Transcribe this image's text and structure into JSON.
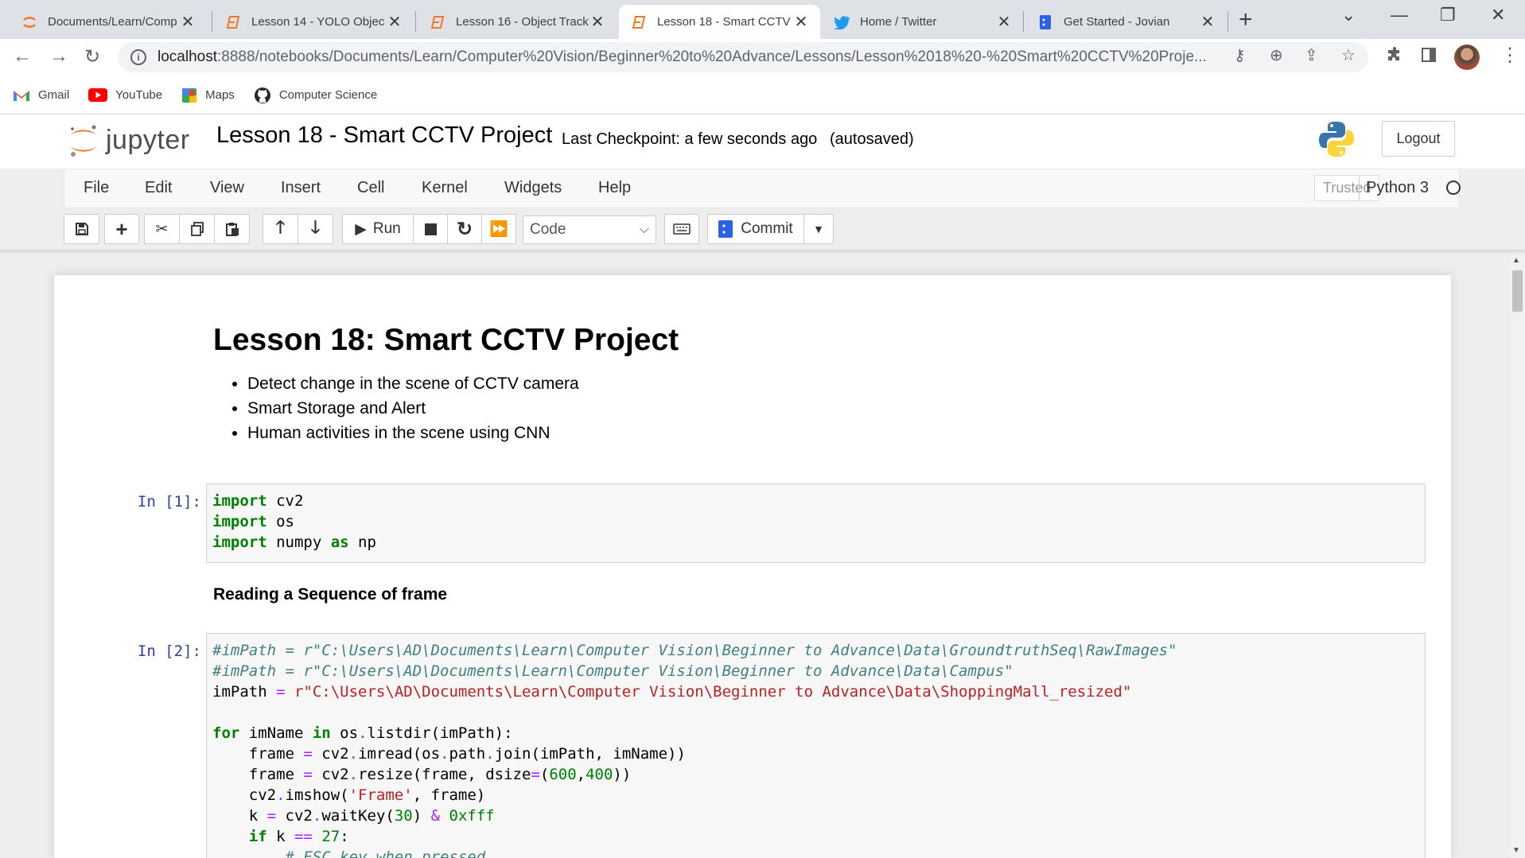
{
  "browser": {
    "tabs": [
      {
        "title": "Documents/Learn/Comp",
        "icon": "jupyter-icon"
      },
      {
        "title": "Lesson 14 - YOLO Objec",
        "icon": "notebook-icon"
      },
      {
        "title": "Lesson 16 - Object Track",
        "icon": "notebook-icon"
      },
      {
        "title": "Lesson 18 - Smart CCTV",
        "icon": "notebook-icon",
        "active": true
      },
      {
        "title": "Home / Twitter",
        "icon": "twitter-icon"
      },
      {
        "title": "Get Started - Jovian",
        "icon": "jovian-icon"
      }
    ],
    "url_host": "localhost",
    "url_rest": ":8888/notebooks/Documents/Learn/Computer%20Vision/Beginner%20to%20Advance/Lessons/Lesson%2018%20-%20Smart%20CCTV%20Proje...",
    "bookmarks": [
      {
        "label": "Gmail",
        "icon": "gmail-icon"
      },
      {
        "label": "YouTube",
        "icon": "youtube-icon"
      },
      {
        "label": "Maps",
        "icon": "maps-icon"
      },
      {
        "label": "Computer Science",
        "icon": "github-icon"
      }
    ]
  },
  "jupyter": {
    "wordmark": "jupyter",
    "notebook_title": "Lesson 18 - Smart CCTV Project",
    "checkpoint": "Last Checkpoint: a few seconds ago",
    "autosave": "(autosaved)",
    "logout": "Logout",
    "menu": [
      "File",
      "Edit",
      "View",
      "Insert",
      "Cell",
      "Kernel",
      "Widgets",
      "Help"
    ],
    "trusted": "Trusted",
    "kernel": "Python 3",
    "toolbar": {
      "run": "Run",
      "cell_type": "Code",
      "commit": "Commit"
    }
  },
  "notebook": {
    "heading": "Lesson 18: Smart CCTV Project",
    "bullets": [
      "Detect change in the scene of CCTV camera",
      "Smart Storage and Alert",
      "Human activities in the scene using CNN"
    ],
    "cell1_prompt": "In [1]:",
    "section_heading": "Reading a Sequence of frame",
    "cell2_prompt": "In [2]:"
  },
  "colors": {
    "keyword": "#008000",
    "comment": "#408080",
    "string": "#ba2121",
    "prompt": "#303f9f",
    "jupyter_orange": "#f37726"
  }
}
